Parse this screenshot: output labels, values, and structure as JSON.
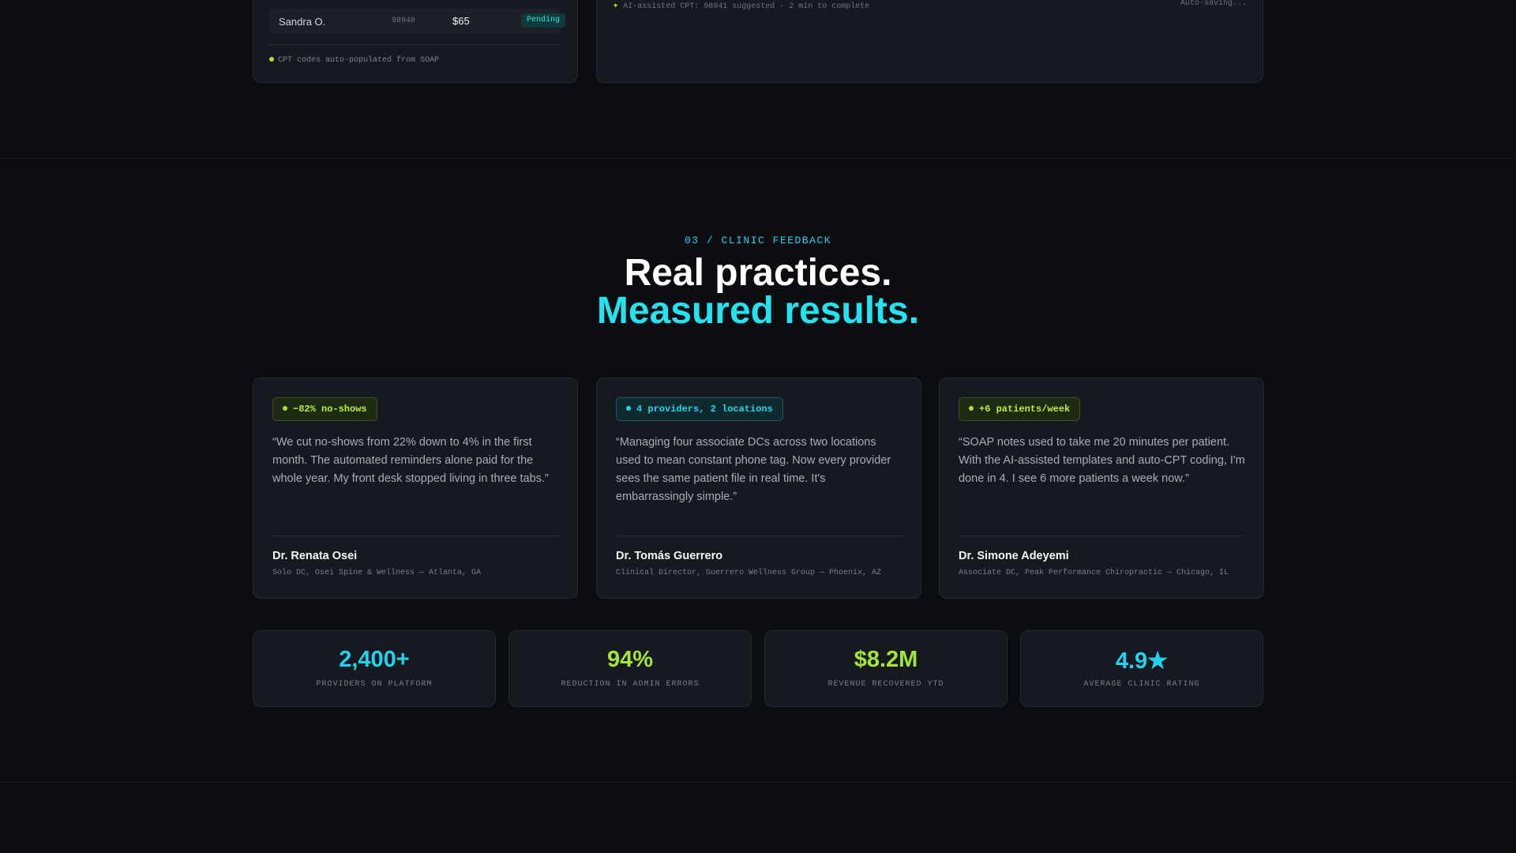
{
  "billing_card": {
    "row": {
      "name": "Sandra O.",
      "code": "98940",
      "amount": "$65",
      "status": "Pending"
    },
    "note": "CPT codes auto-populated from SOAP"
  },
  "soap_card": {
    "status": "AI-assisted CPT: 98941 suggested · 2 min to complete",
    "autosave": "Auto-saving..."
  },
  "section": {
    "eyebrow": "03 / CLINIC FEEDBACK",
    "headline_line1": "Real practices.",
    "headline_line2": "Measured results."
  },
  "testimonials": [
    {
      "chip": "−82% no-shows",
      "quote": "“We cut no-shows from 22% down to 4% in the first month. The automated reminders alone paid for the whole year. My front desk stopped living in three tabs.”",
      "name": "Dr. Renata Osei",
      "role": "Solo DC, Osei Spine & Wellness — Atlanta, GA"
    },
    {
      "chip": "4 providers, 2 locations",
      "quote": "“Managing four associate DCs across two locations used to mean constant phone tag. Now every provider sees the same patient file in real time. It's embarrassingly simple.”",
      "name": "Dr. Tomás Guerrero",
      "role": "Clinical Director, Guerrero Wellness Group — Phoenix, AZ"
    },
    {
      "chip": "+6 patients/week",
      "quote": "“SOAP notes used to take me 20 minutes per patient. With the AI-assisted templates and auto-CPT coding, I'm done in 4. I see 6 more patients a week now.”",
      "name": "Dr. Simone Adeyemi",
      "role": "Associate DC, Peak Performance Chiropractic — Chicago, IL"
    }
  ],
  "stats": [
    {
      "value": "2,400+",
      "label": "PROVIDERS ON PLATFORM"
    },
    {
      "value": "94%",
      "label": "REDUCTION IN ADMIN ERRORS"
    },
    {
      "value": "$8.2M",
      "label": "REVENUE RECOVERED YTD"
    },
    {
      "value": "4.9★",
      "label": "AVERAGE CLINIC RATING"
    }
  ],
  "colors": {
    "background": "#0b0d10",
    "card": "#16191f",
    "accent_cyan": "#22d3ee",
    "accent_lime": "#a3e635"
  }
}
